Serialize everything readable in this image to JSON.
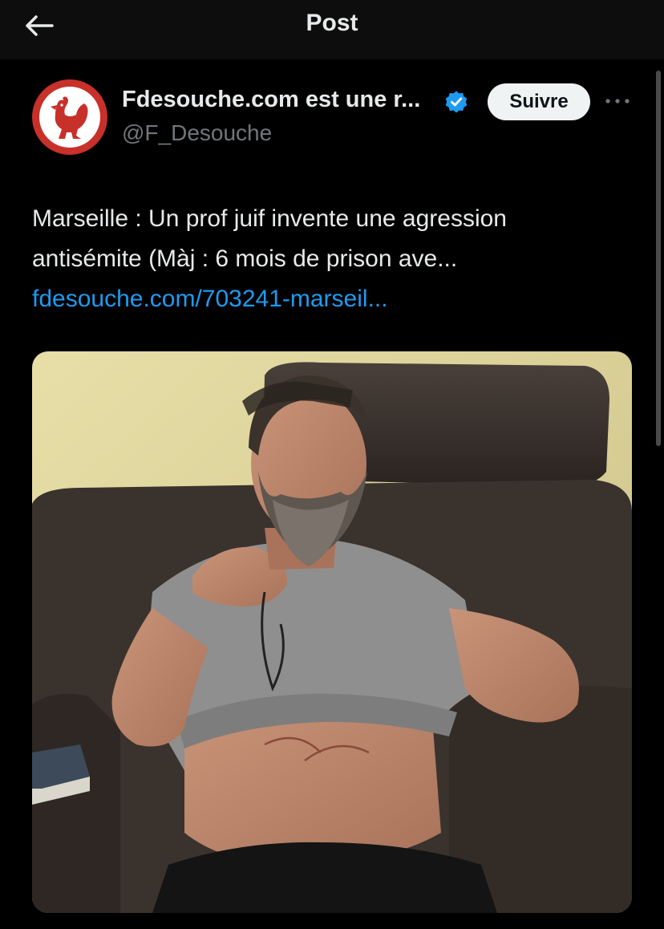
{
  "header": {
    "title": "Post",
    "back_icon": "arrow-left-icon"
  },
  "post": {
    "author": {
      "display_name": "Fdesouche.com est une r...",
      "handle": "@F_Desouche",
      "verified": true,
      "avatar_icon": "rooster-logo"
    },
    "follow_label": "Suivre",
    "more_icon": "more-options-icon",
    "text_lines": [
      "Marseille : Un prof juif invente une agression",
      "antisémite (Màj : 6 mois de prison ave..."
    ],
    "link_text": "fdesouche.com/703241-marseil...",
    "media_icon": "photo-image"
  },
  "colors": {
    "background": "#000000",
    "header_background": "#0d0d0d",
    "text_primary": "#e7e9ea",
    "text_secondary": "#71767b",
    "link": "#1d9bf0",
    "verified_badge": "#1d9bf0",
    "follow_button_bg": "#eff3f4",
    "avatar_red": "#c8302a"
  }
}
